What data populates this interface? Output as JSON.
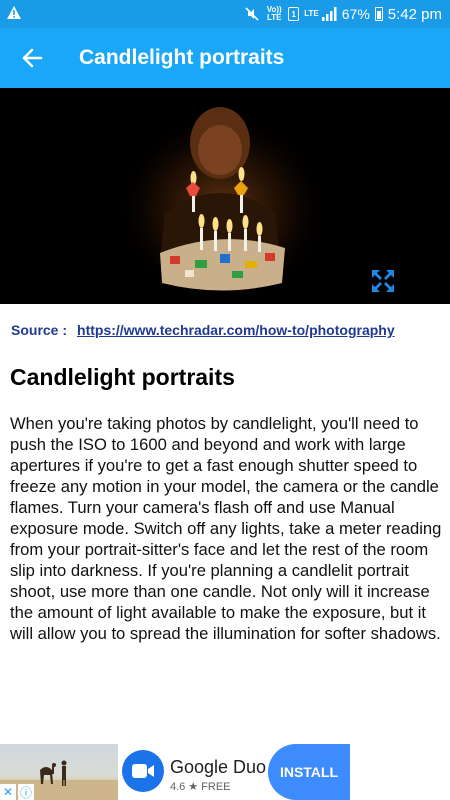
{
  "status_bar": {
    "battery": "67%",
    "time": "5:42 pm",
    "volte": "Vo)) LTE",
    "lte": "LTE",
    "sim": "1"
  },
  "app_bar": {
    "title": "Candlelight portraits"
  },
  "source": {
    "label": "Source :",
    "url": "https://www.techradar.com/how-to/photography"
  },
  "article": {
    "heading": "Candlelight portraits",
    "body": "When you're taking photos by candlelight, you'll need to push the ISO to 1600 and beyond and work with large apertures if you're to get a fast enough shutter speed to freeze any motion in your model, the camera or the candle flames. Turn your camera's flash off and use Manual exposure mode. Switch off any lights, take a meter reading from your portrait-sitter's face and let the rest of the room slip into darkness. If you're planning a candlelit portrait shoot, use more than one candle. Not only will it increase the amount of light available to make the exposure, but it will allow you to spread the illumination for softer shadows."
  },
  "ad": {
    "app_name": "Google Duo",
    "rating": "4.6",
    "star": "★",
    "price": "FREE",
    "install_label": "INSTALL",
    "close_glyph": "✕",
    "info_glyph": "ⓘ"
  },
  "colors": {
    "status_bar": "#1a9be8",
    "app_bar": "#1ba7f7",
    "link": "#1f3a93",
    "install": "#3d8bfd"
  },
  "icons": [
    "warning-icon",
    "mute-icon",
    "signal-icon",
    "battery-icon",
    "back-arrow-icon",
    "expand-icon",
    "duo-camera-icon"
  ]
}
